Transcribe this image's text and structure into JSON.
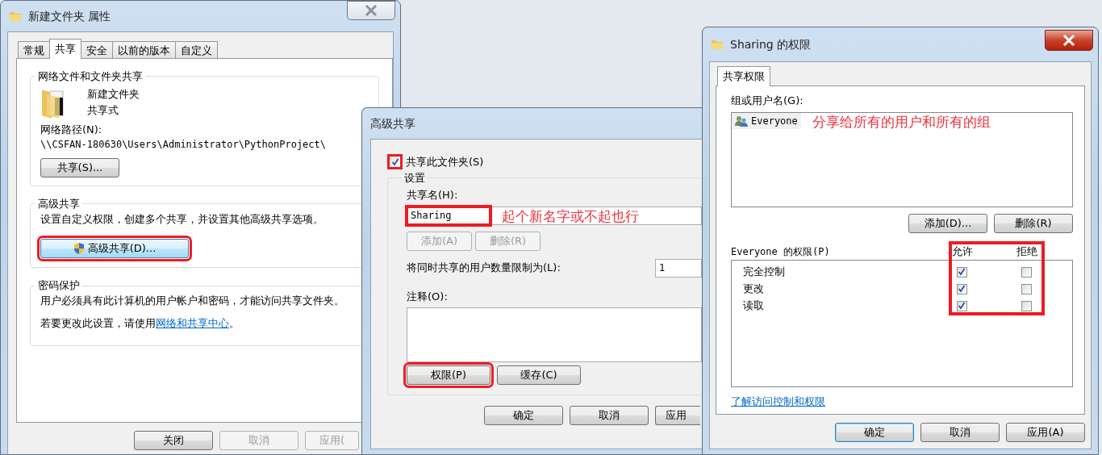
{
  "properties_dialog": {
    "title": "新建文件夹 属性",
    "tabs": [
      {
        "label": "常规",
        "selected": false
      },
      {
        "label": "共享",
        "selected": true
      },
      {
        "label": "安全",
        "selected": false
      },
      {
        "label": "以前的版本",
        "selected": false
      },
      {
        "label": "自定义",
        "selected": false
      }
    ],
    "network_group": {
      "title": "网络文件和文件夹共享",
      "folder_name": "新建文件夹",
      "folder_state": "共享式",
      "path_label": "网络路径(N):",
      "path": "\\\\CSFAN-180630\\Users\\Administrator\\PythonProject\\",
      "share_button": "共享(S)..."
    },
    "advanced_group": {
      "title": "高级共享",
      "description": "设置自定义权限，创建多个共享，并设置其他高级共享选项。",
      "button": {
        "label": "高级共享(D)...",
        "highlighted": true
      }
    },
    "password_group": {
      "title": "密码保护",
      "description": "用户必须具有此计算机的用户帐户和密码，才能访问共享文件夹。",
      "hint": "若要更改此设置，请使用",
      "link": "网络和共享中心",
      "hint_end": "。"
    },
    "buttons": [
      {
        "label": "关闭",
        "disabled": false
      },
      {
        "label": "取消",
        "disabled": true
      },
      {
        "label": "应用(",
        "disabled": true
      }
    ]
  },
  "advanced_sharing_dialog": {
    "title": "高级共享",
    "share_checkbox": {
      "label": "共享此文件夹(S)",
      "checked": true,
      "highlighted": true
    },
    "settings_group": {
      "title": "设置",
      "share_name_label": "共享名(H):",
      "share_name": "Sharing",
      "share_name_highlighted": true,
      "annotation": "起个新名字或不起也行",
      "name_buttons": [
        {
          "label": "添加(A)",
          "disabled": true
        },
        {
          "label": "删除(R)",
          "disabled": true
        }
      ],
      "limit_label": "将同时共享的用户数量限制为(L):",
      "limit_value": "1",
      "comment_label": "注释(O):",
      "action_buttons": [
        {
          "label": "权限(P)",
          "highlighted": true
        },
        {
          "label": "缓存(C)",
          "highlighted": false
        }
      ]
    },
    "buttons": [
      {
        "label": "确定"
      },
      {
        "label": "取消"
      },
      {
        "label": "应用"
      }
    ]
  },
  "permissions_dialog": {
    "title": "Sharing 的权限",
    "tabs": [
      {
        "label": "共享权限",
        "selected": true
      }
    ],
    "users_label": "组或用户名(G):",
    "users": [
      {
        "name": "Everyone",
        "selected": true
      }
    ],
    "annotation": "分享给所有的用户和所有的组",
    "user_buttons": [
      {
        "label": "添加(D)..."
      },
      {
        "label": "删除(R)"
      }
    ],
    "permissions_label": "Everyone 的权限(P)",
    "columns": [
      "允许",
      "拒绝"
    ],
    "columns_highlighted": true,
    "permissions": [
      {
        "name": "完全控制",
        "allow": true,
        "deny": false
      },
      {
        "name": "更改",
        "allow": true,
        "deny": false
      },
      {
        "name": "读取",
        "allow": true,
        "deny": false
      }
    ],
    "link": "了解访问控制和权限",
    "buttons": [
      {
        "label": "确定",
        "default": true
      },
      {
        "label": "取消",
        "default": false
      },
      {
        "label": "应用(A)",
        "default": false
      }
    ]
  }
}
